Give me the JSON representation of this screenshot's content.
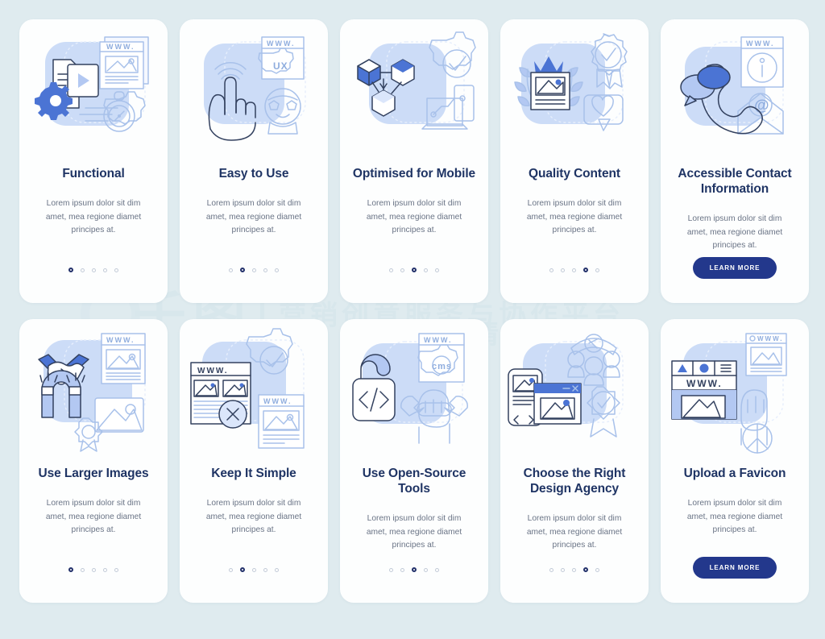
{
  "page": {
    "background_color": "#dfebef",
    "card_background": "#fdfefe",
    "title_color": "#1f3464",
    "body_color": "#6a7486",
    "accent_color": "#4b74d4",
    "button_color": "#23388c"
  },
  "watermark": {
    "logo_text": "千图",
    "line1": "营销创意服务与协作平台",
    "line2": "商用请获取授权"
  },
  "common": {
    "body_text": "Lorem ipsum dolor sit dim amet, mea regione diamet principes at.",
    "dot_count": 5,
    "learn_more_label": "LEARN MORE"
  },
  "cards": [
    {
      "id": "functional",
      "title": "Functional",
      "body": "Lorem ipsum dolor sit dim amet, mea regione diamet principes at.",
      "footer": "dots",
      "active_dot": 0,
      "illustration": "document-play-gear-compass-www-icon"
    },
    {
      "id": "easy-to-use",
      "title": "Easy to Use",
      "body": "Lorem ipsum dolor sit dim amet, mea regione diamet principes at.",
      "footer": "dots",
      "active_dot": 1,
      "illustration": "tap-hand-ux-window-happy-face-icon"
    },
    {
      "id": "optimised-for-mobile",
      "title": "Optimised for Mobile",
      "body": "Lorem ipsum dolor sit dim amet, mea regione diamet principes at.",
      "footer": "dots",
      "active_dot": 2,
      "illustration": "cubes-network-gear-check-devices-icon"
    },
    {
      "id": "quality-content",
      "title": "Quality Content",
      "body": "Lorem ipsum dolor sit dim amet, mea regione diamet principes at.",
      "footer": "dots",
      "active_dot": 3,
      "illustration": "crown-image-laurel-award-heart-icon"
    },
    {
      "id": "accessible-contact-information",
      "title": "Accessible Contact Information",
      "body": "Lorem ipsum dolor sit dim amet, mea regione diamet principes at.",
      "footer": "button",
      "button_label": "LEARN MORE",
      "illustration": "phone-chat-info-window-email-icon"
    },
    {
      "id": "use-larger-images",
      "title": "Use Larger Images",
      "body": "Lorem ipsum dolor sit dim amet, mea regione diamet principes at.",
      "footer": "dots",
      "active_dot": 0,
      "illustration": "handshake-magnet-www-image-badge-icon"
    },
    {
      "id": "keep-it-simple",
      "title": "Keep It Simple",
      "body": "Lorem ipsum dolor sit dim amet, mea regione diamet principes at.",
      "footer": "dots",
      "active_dot": 1,
      "illustration": "cluttered-page-cross-gear-check-simple-page-icon"
    },
    {
      "id": "use-open-source-tools",
      "title": "Use Open-Source Tools",
      "body": "Lorem ipsum dolor sit dim amet, mea regione diamet principes at.",
      "footer": "dots",
      "active_dot": 2,
      "illustration": "open-padlock-code-cms-window-wrench-hand-icon"
    },
    {
      "id": "choose-the-right-design-agency",
      "title": "Choose the Right Design Agency",
      "body": "Lorem ipsum dolor sit dim amet, mea regione diamet principes at.",
      "footer": "dots",
      "active_dot": 3,
      "illustration": "team-browser-windows-award-badge-icon"
    },
    {
      "id": "upload-a-favicon",
      "title": "Upload a Favicon",
      "body": "Lorem ipsum dolor sit dim amet, mea regione diamet principes at.",
      "footer": "button",
      "button_label": "LEARN MORE",
      "illustration": "browser-favicon-www-fist-icon"
    }
  ],
  "illustration_labels": {
    "www": "WWW.",
    "ux": "UX",
    "cms": "cms"
  }
}
